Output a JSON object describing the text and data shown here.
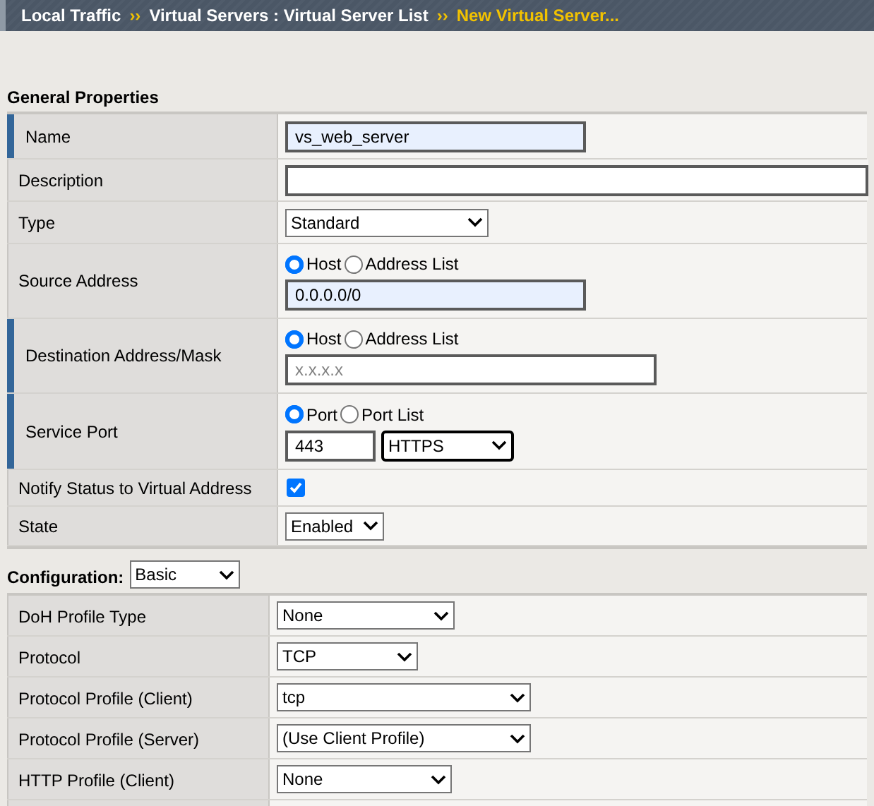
{
  "breadcrumb": [
    {
      "text": "Local Traffic",
      "current": false
    },
    {
      "separator": "››",
      "text": "Virtual Servers : Virtual Server List",
      "current": false
    },
    {
      "separator": "››",
      "text": "New Virtual Server...",
      "current": true
    }
  ],
  "general": {
    "heading": "General Properties",
    "rows": [
      {
        "label": "Name",
        "required": true,
        "kind": "text",
        "value": "vs_web_server",
        "autofilled": true
      },
      {
        "label": "Description",
        "required": false,
        "kind": "text",
        "value": "",
        "autofilled": false
      },
      {
        "label": "Type",
        "required": false,
        "kind": "select",
        "value": "Standard"
      },
      {
        "label": "Source Address",
        "required": false,
        "kind": "radio_text",
        "radios": [
          {
            "label": "Host",
            "selected": true
          },
          {
            "label": "Address List",
            "selected": false
          }
        ],
        "value": "0.0.0.0/0",
        "autofilled": true
      },
      {
        "label": "Destination Address/Mask",
        "required": true,
        "kind": "radio_text",
        "radios": [
          {
            "label": "Host",
            "selected": true
          },
          {
            "label": "Address List",
            "selected": false
          }
        ],
        "placeholder": "x.x.x.x",
        "autofilled": false
      },
      {
        "label": "Service Port",
        "required": true,
        "kind": "radio_port",
        "radios": [
          {
            "label": "Port",
            "selected": true
          },
          {
            "label": "Port List",
            "selected": false
          }
        ],
        "value": "443",
        "select": "HTTPS"
      },
      {
        "label": "Notify Status to Virtual Address",
        "required": false,
        "kind": "checkbox",
        "checked": true
      },
      {
        "label": "State",
        "required": false,
        "kind": "select",
        "value": "Enabled"
      }
    ]
  },
  "configuration": {
    "heading": "Configuration:",
    "mode": "Basic",
    "rows": [
      {
        "label": "DoH Profile Type",
        "value": "None"
      },
      {
        "label": "Protocol",
        "value": "TCP"
      },
      {
        "label": "Protocol Profile (Client)",
        "value": "tcp"
      },
      {
        "label": "Protocol Profile (Server)",
        "value": "(Use Client Profile)"
      },
      {
        "label": "HTTP Profile (Client)",
        "value": "None"
      }
    ]
  }
}
